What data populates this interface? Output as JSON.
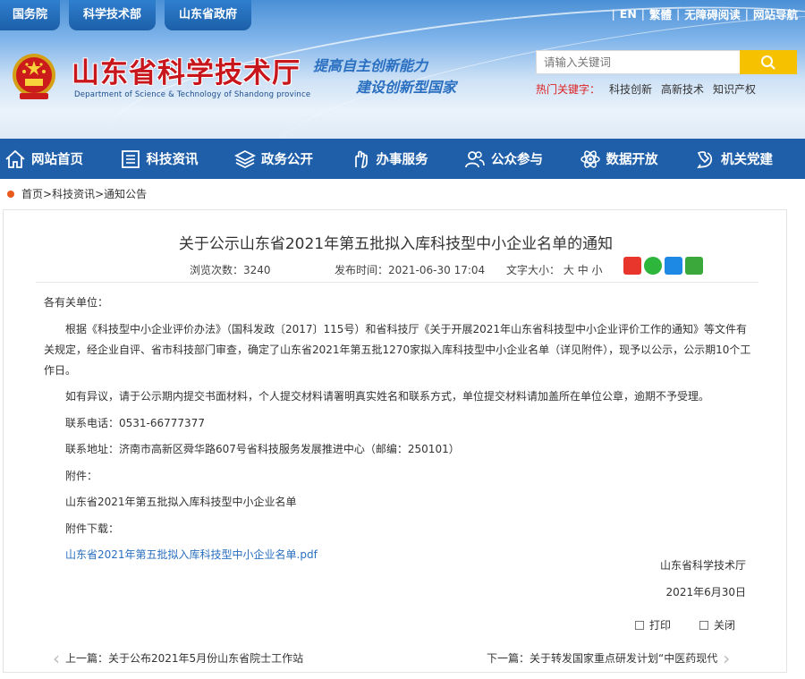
{
  "header": {
    "top_links": [
      "国务院",
      "科学技术部",
      "山东省政府"
    ],
    "right_links": [
      "EN",
      "繁體",
      "无障碍阅读",
      "网站导航"
    ],
    "site_title": "山东省科学技术厅",
    "site_subtitle": "Department of Science & Technology of Shandong province",
    "slogan_line1": "提高自主创新能力",
    "slogan_line2": "建设创新型国家",
    "search_placeholder": "请输入关键词",
    "hot_label": "热门关键字：",
    "hot_keywords": [
      "科技创新",
      "高新技术",
      "知识产权"
    ]
  },
  "nav": {
    "items": [
      {
        "label": "网站首页",
        "icon": "home-icon"
      },
      {
        "label": "科技资讯",
        "icon": "news-icon"
      },
      {
        "label": "政务公开",
        "icon": "layers-icon"
      },
      {
        "label": "办事服务",
        "icon": "hand-icon"
      },
      {
        "label": "公众参与",
        "icon": "people-icon"
      },
      {
        "label": "数据开放",
        "icon": "atom-icon"
      },
      {
        "label": "机关党建",
        "icon": "party-icon"
      }
    ]
  },
  "breadcrumb": [
    "首页",
    ">",
    "科技资讯",
    ">",
    "通知公告"
  ],
  "article": {
    "title": "关于公示山东省2021年第五批拟入库科技型中小企业名单的通知",
    "views_label": "浏览次数：",
    "views_value": "3240",
    "date_label": "发布时间：",
    "date_value": "2021-06-30 17:04",
    "fontsize_label": "文字大小：",
    "font_large": "大",
    "font_medium": "中",
    "font_small": "小",
    "greeting": "各有关单位：",
    "para1": "根据《科技型中小企业评价办法》（国科发政〔2017〕115号）和省科技厅《关于开展2021年山东省科技型中小企业评价工作的通知》等文件有关规定，经企业自评、省市科技部门审查，确定了山东省2021年第五批1270家拟入库科技型中小企业名单（详见附件），现予以公示，公示期10个工作日。",
    "para2": "如有异议，请于公示期内提交书面材料，个人提交材料请署明真实姓名和联系方式，单位提交材料请加盖所在单位公章，逾期不予受理。",
    "phone": "联系电话：0531-66777377",
    "address": "联系地址：济南市高新区舜华路607号省科技服务发展推进中心（邮编：250101）",
    "attach_label": "附件：",
    "attach_name": "山东省2021年第五批拟入库科技型中小企业名单",
    "download_label": "附件下载：",
    "download_link": "山东省2021年第五批拟入库科技型中小企业名单.pdf",
    "signature": "山东省科学技术厅",
    "sign_date": "2021年6月30日",
    "print_label": "打印",
    "close_label": "关闭",
    "prev": "上一篇：关于公布2021年5月份山东省院士工作站",
    "next": "下一篇：关于转发国家重点研发计划“中医药现代"
  },
  "colors": {
    "nav_bg": "#1f5fa9",
    "title_red": "#c8161d",
    "search_btn": "#f6c200",
    "link_blue": "#2a6fc0"
  }
}
